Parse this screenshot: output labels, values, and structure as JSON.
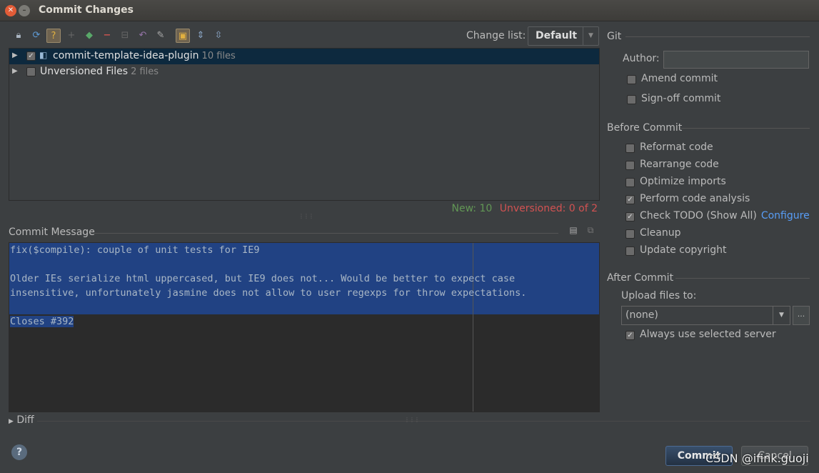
{
  "window": {
    "title": "Commit Changes"
  },
  "toolbar": {
    "icons": [
      "lock-icon",
      "refresh-icon",
      "question-icon",
      "plus-icon",
      "shield-icon",
      "minus-icon",
      "diff-icon",
      "undo-icon",
      "edit-icon",
      "group-icon",
      "expand-icon",
      "collapse-icon"
    ]
  },
  "changelist": {
    "label": "Change list:",
    "value": "Default"
  },
  "tree": {
    "rows": [
      {
        "label": "commit-template-idea-plugin",
        "count": "10 files",
        "checked": true
      },
      {
        "label": "Unversioned Files",
        "count": "2 files",
        "checked": false
      }
    ]
  },
  "stats": {
    "new": "New: 10",
    "unversioned": "Unversioned: 0 of 2"
  },
  "commit_message": {
    "label": "Commit Message",
    "lines": [
      "fix($compile): couple of unit tests for IE9",
      "",
      "Older IEs serialize html uppercased, but IE9 does not... Would be better to expect case",
      "insensitive, unfortunately jasmine does not allow to user regexps for throw expectations.",
      "",
      "Closes #392"
    ]
  },
  "diff": {
    "label": "Diff"
  },
  "git": {
    "title": "Git",
    "author_label": "Author:",
    "author_value": "",
    "amend": "Amend commit",
    "signoff": "Sign-off commit"
  },
  "before_commit": {
    "title": "Before Commit",
    "options": [
      {
        "label": "Reformat code",
        "checked": false
      },
      {
        "label": "Rearrange code",
        "checked": false
      },
      {
        "label": "Optimize imports",
        "checked": false
      },
      {
        "label": "Perform code analysis",
        "checked": true
      },
      {
        "label": "Check TODO (Show All)",
        "checked": true,
        "link": "Configure"
      },
      {
        "label": "Cleanup",
        "checked": false
      },
      {
        "label": "Update copyright",
        "checked": false
      }
    ]
  },
  "after_commit": {
    "title": "After Commit",
    "upload_label": "Upload files to:",
    "upload_value": "(none)",
    "more": "...",
    "always_label": "Always use selected server"
  },
  "buttons": {
    "help": "?",
    "commit": "Commit",
    "cancel": "Cancel"
  },
  "watermark": "CSDN @ifink.guoji"
}
